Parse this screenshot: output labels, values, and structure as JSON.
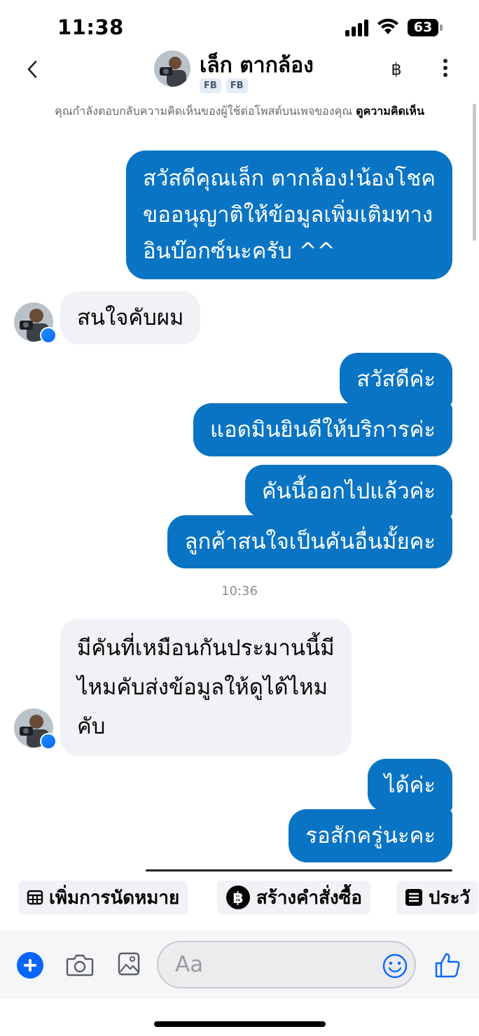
{
  "status_bar": {
    "time": "11:38",
    "battery": "63"
  },
  "header": {
    "contact_name": "เล็ก ตากล้อง",
    "badges": [
      "FB",
      "FB"
    ],
    "currency_symbol": "฿"
  },
  "notice": {
    "text": "คุณกำลังตอบกลับความคิดเห็นของผู้ใช้ต่อโพสต์บนเพจของคุณ",
    "link": "ดูความคิดเห็น"
  },
  "messages": {
    "m1": [
      "สวัสดีคุณเล็ก ตากล้อง!น้องโชค",
      "ขออนุญาติให้ข้อมูลเพิ่มเติมทาง",
      "อินบ๊อกซ์นะครับ ^^"
    ],
    "m2": "สนใจคับผม",
    "m3": "สวัสดีค่ะ",
    "m4": "แอดมินยินดีให้บริการค่ะ",
    "m5": "คันนี้ออกไปแล้วค่ะ",
    "m6": "ลูกค้าสนใจเป็นคันอื่นมั้ยคะ",
    "time": "10:36",
    "m7": [
      "มีคันที่เหมือนกันประมานนี้มี",
      "ไหมคับส่งข้อมูลให้ดูได้ไหม",
      "คับ"
    ],
    "m8": "ได้ค่ะ",
    "m9": "รอสักครู่นะคะ"
  },
  "quick_actions": [
    {
      "label": "เพิ่มการนัดหมาย",
      "icon": "calendar-icon"
    },
    {
      "label": "สร้างคำสั่งซื้อ",
      "icon": "baht-icon"
    },
    {
      "label": "ประวั",
      "icon": "list-icon"
    }
  ],
  "composer": {
    "placeholder": "Aa"
  },
  "colors": {
    "outgoing_bubble": "#0a74c4",
    "incoming_bubble": "#f0f2f5",
    "accent": "#0866ff"
  }
}
